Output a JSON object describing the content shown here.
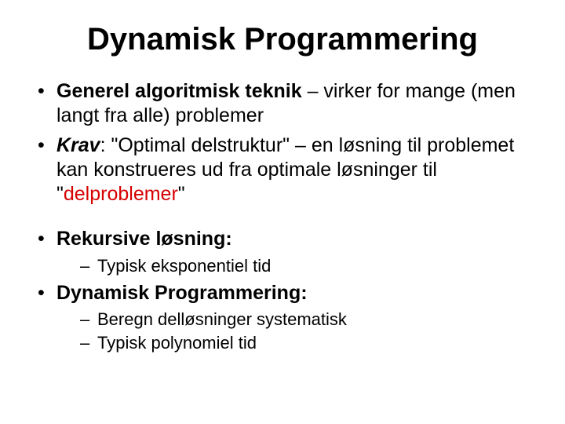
{
  "title": "Dynamisk Programmering",
  "bullet1": {
    "bold": "Generel algoritmisk teknik",
    "rest": " – virker for mange (men langt fra alle) problemer"
  },
  "bullet2": {
    "label": "Krav",
    "before": ": \"Optimal delstruktur\" – en løsning til problemet kan konstrueres ud fra optimale løsninger til \"",
    "red": "delproblemer",
    "after": "\""
  },
  "bullet3": {
    "heading": "Rekursive løsning:",
    "sub1": "Typisk eksponentiel tid"
  },
  "bullet4": {
    "heading": "Dynamisk Programmering:",
    "sub1": "Beregn delløsninger systematisk",
    "sub2": "Typisk polynomiel tid"
  }
}
